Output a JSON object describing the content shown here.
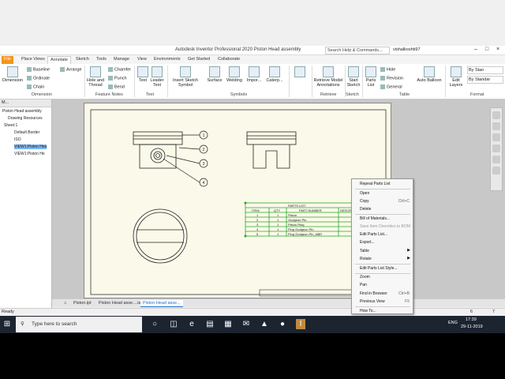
{
  "title_bar": {
    "title": "Autodesk Inventor Professional 2020    Piston Head assembly",
    "search_placeholder": "Search Help & Commands...",
    "user": "vishalkoshti97"
  },
  "ribbon_tabs": [
    "File",
    "Place Views",
    "Annotate",
    "Sketch",
    "Tools",
    "Manage",
    "View",
    "Environments",
    "Get Started",
    "Collaborate"
  ],
  "active_tab": "Annotate",
  "ribbon": {
    "dimension": {
      "big": "Dimension",
      "baseline": "Baseline",
      "ordinate": "Ordinate",
      "chain": "Chain",
      "arrange": "Arrange",
      "group_label": "Dimension"
    },
    "feature_notes": {
      "hole_thread": "Hole and Thread",
      "chamfer": "Chamfer",
      "punch": "Punch",
      "bend": "Bend",
      "group_label": "Feature Notes"
    },
    "text": {
      "text": "Text",
      "leader_text": "Leader Text",
      "group_label": "Text"
    },
    "symbols": {
      "insert_sketch_symbol": "Insert Sketch Symbol",
      "surface": "Surface",
      "welding": "Welding",
      "impor": "Impor...",
      "caterp": "Caterp...",
      "group_label": "Symbols"
    },
    "retrieve": {
      "retrieve_model": "Retrieve Model Annotations",
      "group_label": "Retrieve"
    },
    "sketch": {
      "start_sketch": "Start Sketch",
      "group_label": "Sketch"
    },
    "table": {
      "parts_list": "Parts List",
      "hole": "Hole",
      "revision": "Revision",
      "general": "General",
      "group_label": "Table"
    },
    "balloon": {
      "auto_balloon": "Auto Balloon"
    },
    "format": {
      "edit_layers": "Edit Layers",
      "by_standard_1": "By Stan",
      "by_standard_2": "By Standar",
      "group_label": "Format"
    }
  },
  "browser": {
    "header": "M...",
    "nodes": [
      "Piston Head assembly",
      "Drawing Resources",
      "Sheet:1",
      "Default Border",
      "ISO",
      "VIEW1:Piston Hea",
      "VIEW1:Piston He"
    ]
  },
  "parts_list": {
    "title": "PARTS LIST",
    "headers": [
      "ITEM",
      "QTY",
      "PART NUMBER",
      "DESCR"
    ],
    "rows": [
      [
        "1",
        "1",
        "Piston",
        ""
      ],
      [
        "2",
        "1",
        "Gudgeon Pin",
        ""
      ],
      [
        "3",
        "1",
        "Piston Ring",
        ""
      ],
      [
        "4",
        "1",
        "Plug Gudgeon Pin",
        ""
      ],
      [
        "5",
        "1",
        "Plug Gudgeon Pin_M8R",
        ""
      ]
    ]
  },
  "balloons": [
    "1",
    "2",
    "3",
    "4",
    "5"
  ],
  "context_menu": [
    {
      "label": "Repeat Parts List",
      "shortcut": "",
      "disabled": false,
      "submenu": false
    },
    {
      "label": "Open",
      "shortcut": "",
      "disabled": false,
      "submenu": false
    },
    {
      "label": "Copy",
      "shortcut": "Ctrl+C",
      "disabled": false,
      "submenu": false
    },
    {
      "label": "Delete",
      "shortcut": "",
      "disabled": false,
      "submenu": false
    },
    {
      "label": "Bill of Materials...",
      "shortcut": "",
      "disabled": false,
      "submenu": false
    },
    {
      "label": "Save Item Overrides to BOM",
      "shortcut": "",
      "disabled": true,
      "submenu": false
    },
    {
      "label": "Edit Parts List...",
      "shortcut": "",
      "disabled": false,
      "submenu": false
    },
    {
      "label": "Export...",
      "shortcut": "",
      "disabled": false,
      "submenu": false
    },
    {
      "label": "Table",
      "shortcut": "",
      "disabled": false,
      "submenu": true
    },
    {
      "label": "Rotate",
      "shortcut": "",
      "disabled": false,
      "submenu": true
    },
    {
      "label": "Edit Parts List Style...",
      "shortcut": "",
      "disabled": false,
      "submenu": false
    },
    {
      "label": "Zoom",
      "shortcut": "",
      "disabled": false,
      "submenu": false
    },
    {
      "label": "Pan",
      "shortcut": "",
      "disabled": false,
      "submenu": false
    },
    {
      "label": "Find in Browser",
      "shortcut": "Ctrl+B",
      "disabled": false,
      "submenu": false
    },
    {
      "label": "Previous View",
      "shortcut": "F5",
      "disabled": false,
      "submenu": false
    },
    {
      "label": "How To...",
      "shortcut": "",
      "disabled": false,
      "submenu": false
    }
  ],
  "doc_tabs": [
    "Piston.ipt",
    "Piston Head asse....iam",
    "Piston Head asse..."
  ],
  "active_doc_tab": "Piston Head asse...",
  "status": {
    "left": "Ready",
    "page_a": "6",
    "page_b": "7"
  },
  "taskbar": {
    "search_placeholder": "Type here to search",
    "time": "17:39",
    "date": "29-11-2019",
    "lang": "ENG"
  },
  "colors": {
    "accent": "#1a6fc9",
    "file_tab": "#f7941d",
    "selection": "#2aa52a",
    "sheet": "#fbf9e9",
    "taskbar": "#1c2430"
  }
}
